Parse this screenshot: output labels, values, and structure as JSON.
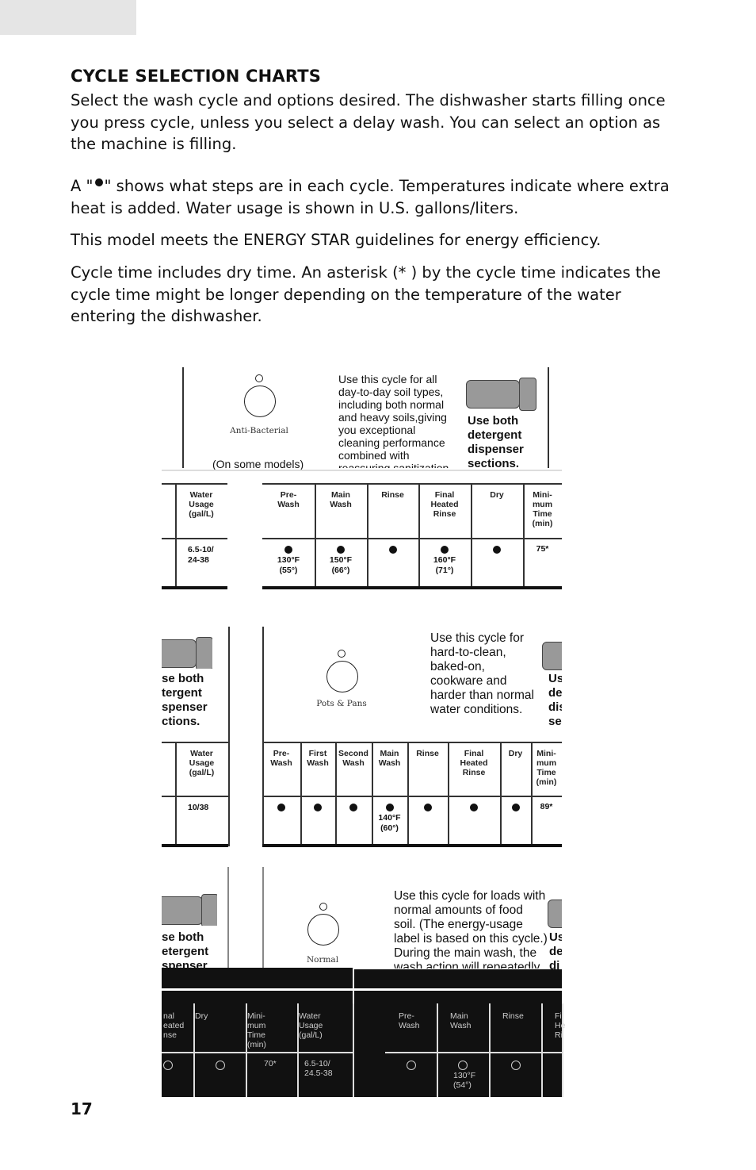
{
  "header": {
    "title": "CYCLE SELECTION CHARTS"
  },
  "paragraphs": [
    "Select the wash cycle and options desired. The dishwasher starts filling once you press cycle, unless you select a delay wash. You can select an option as the machine is filling.",
    "\" shows what steps are in each cycle. Temperatures indicate where extra heat is added. Water usage is shown in U.S. gallons/liters.",
    "This model meets the ENERGY STAR    guidelines for energy efficiency.",
    "Cycle time includes dry time. An asterisk (* ) by the cycle time indicates the cycle time might be longer depending on the temperature of the water entering the dishwasher."
  ],
  "para2_prefix": "A \"",
  "charts": [
    {
      "cycle": "Anti-Bacterial",
      "note": "(On some models)",
      "description": "Use this cycle for all\nday-to-day soil types,\nincluding both normal\nand heavy soils,giving\nyou exceptional\ncleaning performance\ncombined with\nreassuring sanitization",
      "detergent": "Use both\ndetergent\ndispenser\nsections.",
      "water_header": "Water\nUsage\n(gal/L)",
      "water_value": "6.5-10/\n24-38",
      "steps": [
        {
          "label": "Pre-\nWash",
          "dot": true,
          "temp": "130°F\n(55°)"
        },
        {
          "label": "Main\nWash",
          "dot": true,
          "temp": "150°F\n(66°)"
        },
        {
          "label": "Rinse",
          "dot": true,
          "temp": ""
        },
        {
          "label": "Final\nHeated\nRinse",
          "dot": true,
          "temp": "160°F\n(71°)"
        },
        {
          "label": "Dry",
          "dot": true,
          "temp": ""
        },
        {
          "label": "Mini-\nmum\nTime\n(min)",
          "dot": false,
          "temp": "75*"
        }
      ]
    },
    {
      "cycle": "Pots & Pans",
      "description": "Use this cycle for\nhard-to-clean,\nbaked-on,\ncookware and\nharder than normal\nwater conditions.",
      "detergent": "se both\ntergent\nspenser\nctions.",
      "detergent_right": "Us\nde\ndis\nse",
      "water_header": "Water\nUsage\n(gal/L)",
      "water_value": "10/38",
      "steps": [
        {
          "label": "Pre-\nWash",
          "dot": true,
          "temp": ""
        },
        {
          "label": "First\nWash",
          "dot": true,
          "temp": ""
        },
        {
          "label": "Second\nWash",
          "dot": true,
          "temp": ""
        },
        {
          "label": "Main\nWash",
          "dot": true,
          "temp": "140°F\n(60°)"
        },
        {
          "label": "Rinse",
          "dot": true,
          "temp": ""
        },
        {
          "label": "Final\nHeated\nRinse",
          "dot": true,
          "temp": ""
        },
        {
          "label": "Dry",
          "dot": true,
          "temp": ""
        },
        {
          "label": "Mini-\nmum\nTime\n(min)",
          "dot": false,
          "temp": "89*"
        }
      ]
    },
    {
      "cycle": "Normal",
      "description": "Use this cycle for loads with\nnormal amounts of food\nsoil. (The energy-usage\nlabel is based on this cycle.)\nDuring the main wash, the\nwash action will repeatedly",
      "detergent": "se both\netergent\nspenser",
      "detergent_right": "Us\nde\ndi",
      "left_headers": [
        "nal\neated\nnse",
        "Dry",
        "Mini-\nmum\nTime\n(min)",
        "Water\nUsage\n(gal/L)"
      ],
      "left_values": [
        "70*",
        "6.5-10/\n24.5-38"
      ],
      "right_headers": [
        "Pre-\nWash",
        "Main\nWash",
        "Rinse",
        "Fi\nHe\nRi"
      ],
      "right_temp": "130°F\n(54°)"
    }
  ],
  "footer": {
    "page_number": "17"
  }
}
